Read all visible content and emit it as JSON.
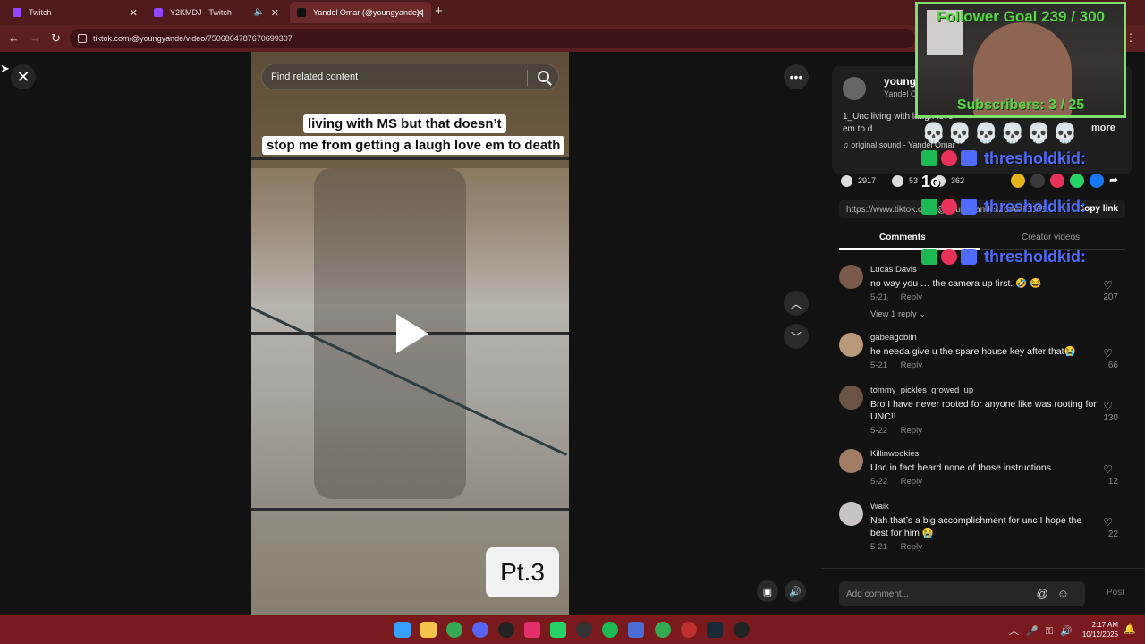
{
  "browser": {
    "tabs": [
      {
        "title": "Twitch",
        "icon_color": "#9146ff"
      },
      {
        "title": "Y2KMDJ - Twitch",
        "icon_color": "#9146ff"
      },
      {
        "title": "Yandel Omar (@youngyande) |",
        "icon_color": "#111111"
      }
    ],
    "url": "tiktok.com/@youngyande/video/7506864787670699307"
  },
  "video": {
    "search_placeholder": "Find related content",
    "caption_line1": "living with MS but that doesn’t",
    "caption_line2": "stop me from getting a laugh love em to death",
    "part_label": "Pt.3"
  },
  "panel": {
    "username": "youngya",
    "nickname": "Yandel Omar",
    "description": "1_Unc living with laugh love em to d",
    "sound": "original sound - Yandel Omar",
    "more_label": "more",
    "stats": {
      "likes": "2917",
      "comments": "53",
      "saves": "362"
    },
    "share_link": "https://www.tiktok.com/@youngyande/video/75068...",
    "copy_link_label": "Copy link",
    "tabs": {
      "comments": "Comments",
      "creator_videos": "Creator videos"
    },
    "comments": [
      {
        "user": "Lucas Davis",
        "text": "no way you … the camera up first. 🤣 😂",
        "date": "5-21",
        "reply": "Reply",
        "likes": "207",
        "view_replies": "View 1 reply ⌄",
        "avatar_color": "#7a5a4a"
      },
      {
        "user": "gabeagoblin",
        "text": "he needa give u the spare house key after that😭",
        "date": "5-21",
        "reply": "Reply",
        "likes": "66",
        "avatar_color": "#b89a7a"
      },
      {
        "user": "tommy_pickles_growed_up",
        "text": "Bro I have never rooted for anyone like was rooting for UNC!!",
        "date": "5-22",
        "reply": "Reply",
        "likes": "130",
        "avatar_color": "#6b5446"
      },
      {
        "user": "Killinwookies",
        "text": "Unc in fact heard none of those instructions",
        "date": "5-22",
        "reply": "Reply",
        "likes": "12",
        "avatar_color": "#a07d64"
      },
      {
        "user": "Walk",
        "text": "Nah that’s a big accomplishment for unc I hope the best for him 😭",
        "date": "5-21",
        "reply": "Reply",
        "likes": "22",
        "avatar_color": "#c9c4c4"
      }
    ],
    "add_comment_placeholder": "Add comment...",
    "post_label": "Post"
  },
  "overlay": {
    "follower_goal": "Follower Goal 239 / 300",
    "subscribers": "Subscribers: 3 / 25",
    "skulls": "💀💀💀💀💀💀",
    "chat_user": "thresholdkid:",
    "chat_fragment": "1o"
  },
  "taskbar": {
    "time": "2:17 AM",
    "date": "10/12/2025"
  },
  "colors": {
    "tab_strip": "#4e1a1c",
    "toolbar": "#5b1f22",
    "taskbar": "#7a1a1f",
    "overlay_green": "#5fd44a",
    "chat_blue": "#4f6cff"
  }
}
